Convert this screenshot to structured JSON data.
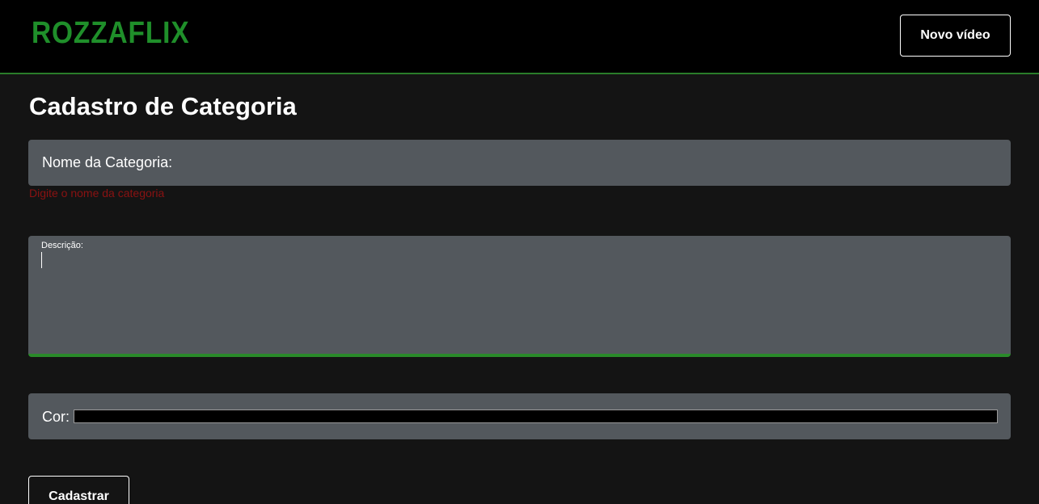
{
  "header": {
    "logo_text": "ROZZAFLIX",
    "new_video_label": "Novo vídeo"
  },
  "page": {
    "title": "Cadastro de Categoria"
  },
  "form": {
    "name_label": "Nome da Categoria:",
    "name_value": "",
    "name_hint": "Digite o nome da categoria",
    "description_label": "Descrição:",
    "description_value": "",
    "color_label": "Cor:",
    "color_value": "#000000",
    "submit_label": "Cadastrar"
  },
  "colors": {
    "brand_green": "#1f8f2a",
    "field_bg": "#53585d",
    "page_bg": "#141414",
    "error_text": "#8a1212"
  }
}
